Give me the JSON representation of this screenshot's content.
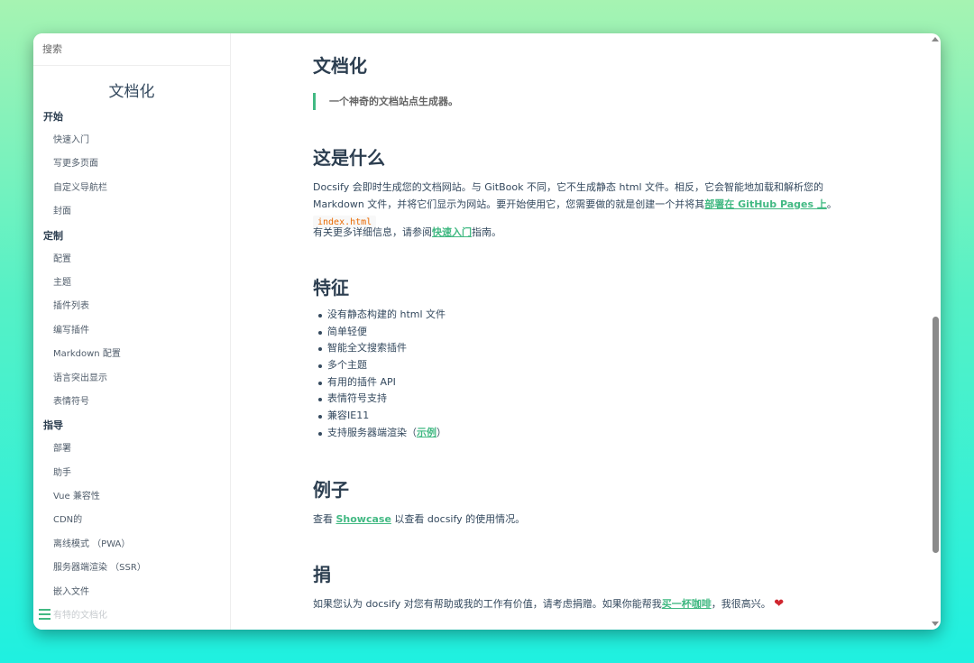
{
  "search": {
    "placeholder": "搜索"
  },
  "sidebar": {
    "app_name": "文档化",
    "sections": [
      {
        "title": "开始",
        "items": [
          "快速入门",
          "写更多页面",
          "自定义导航栏",
          "封面"
        ]
      },
      {
        "title": "定制",
        "items": [
          "配置",
          "主题",
          "插件列表",
          "编写插件",
          "Markdown 配置",
          "语言突出显示",
          "表情符号"
        ]
      },
      {
        "title": "指导",
        "items": [
          "部署",
          "助手",
          "Vue 兼容性",
          "CDN的",
          "离线模式 （PWA）",
          "服务器端渲染 （SSR）",
          "嵌入文件"
        ]
      }
    ],
    "faded_item": "有特的文档化"
  },
  "main": {
    "title": "文档化",
    "quote": "一个神奇的文档站点生成器。",
    "what": {
      "heading": "这是什么",
      "p1_a": "Docsify 会即时生成您的文档网站。与 GitBook 不同，它不生成静态 html 文件。相反，它会智能地加载和解析您的 Markdown 文件，并将它们显示为网站。要开始使用它，您需要做的就是创建一个并将其",
      "p1_link": "部署在 GitHub Pages 上",
      "p1_b": "。",
      "p1_code": "index.html",
      "p2_a": "有关更多详细信息，请参阅",
      "p2_link": "快速入门",
      "p2_b": "指南。"
    },
    "features": {
      "heading": "特征",
      "items": [
        "没有静态构建的 html 文件",
        "简单轻便",
        "智能全文搜索插件",
        "多个主题",
        "有用的插件 API",
        "表情符号支持",
        "兼容IE11"
      ],
      "last_item_a": "支持服务器端渲染（",
      "last_item_link": "示例",
      "last_item_b": "）"
    },
    "examples": {
      "heading": "例子",
      "p_a": "查看 ",
      "p_link": "Showcase",
      "p_b": " 以查看 docsify 的使用情况。"
    },
    "donate": {
      "heading": "捐",
      "p_a": "如果您认为 docsify 对您有帮助或我的工作有价值，请考虑捐赠。如果你能帮我",
      "p_link": "买一杯咖啡",
      "p_b": "，我很高兴。",
      "heart": "❤"
    }
  },
  "colors": {
    "accent": "#42b983",
    "text": "#34495e",
    "code": "#e96900"
  }
}
